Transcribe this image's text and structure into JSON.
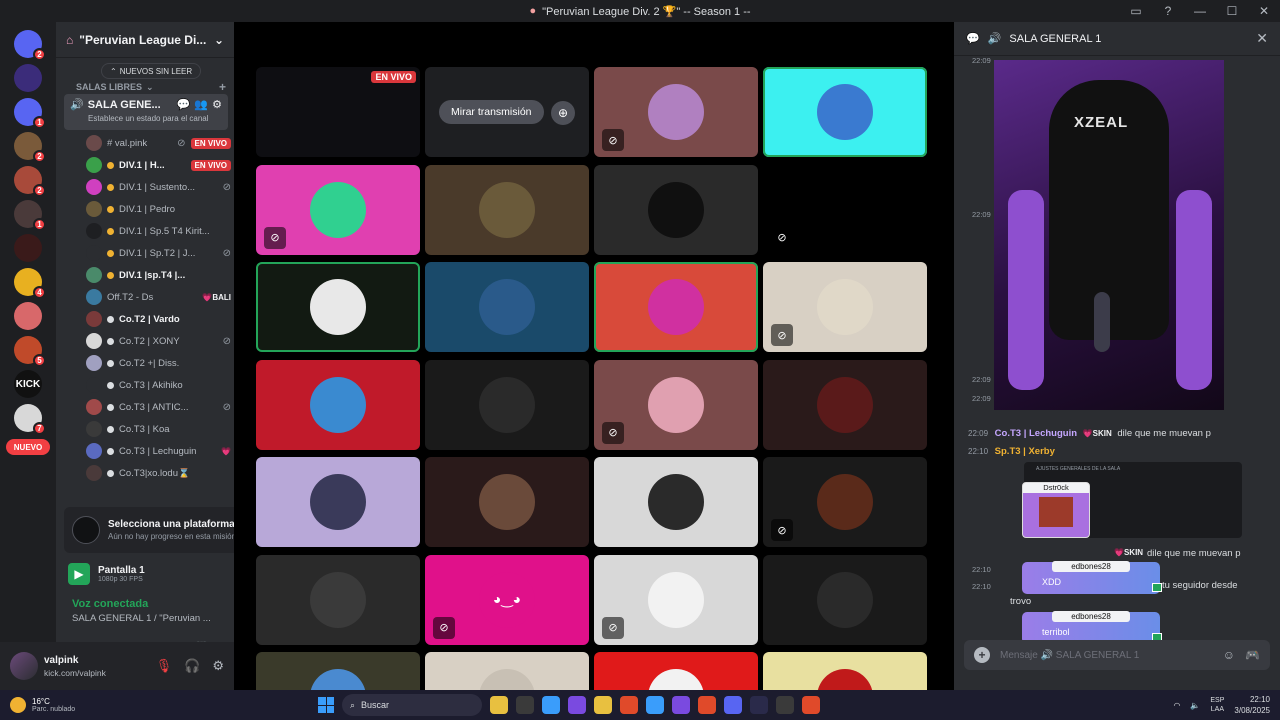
{
  "window": {
    "title": "\"Peruvian League Div. 2 🏆\" -- Season 1 --",
    "controls": [
      "▭",
      "?",
      "—",
      "☐",
      "✕"
    ]
  },
  "servers": [
    {
      "label": "",
      "color": "#5865f2",
      "badge": "2"
    },
    {
      "label": "",
      "color": "#3b2c7a",
      "badge": ""
    },
    {
      "label": "",
      "color": "#5865f2",
      "badge": "1"
    },
    {
      "label": "",
      "color": "#7a5a3a",
      "badge": "2"
    },
    {
      "label": "",
      "color": "#a84a3a",
      "badge": "2"
    },
    {
      "label": "",
      "color": "#4a3a3a",
      "badge": "1"
    },
    {
      "label": "",
      "color": "#3a1a1a",
      "badge": ""
    },
    {
      "label": "",
      "color": "#e8b020",
      "badge": "4"
    },
    {
      "label": "",
      "color": "#d8686a",
      "badge": ""
    },
    {
      "label": "",
      "color": "#c04a2a",
      "badge": "5"
    },
    {
      "label": "KICK",
      "color": "#111",
      "badge": ""
    },
    {
      "label": "",
      "color": "#d8d8d8",
      "badge": "7"
    }
  ],
  "nuevo_label": "NUEVO",
  "guild": {
    "name": "\"Peruvian League Di...",
    "unread_label": "NUEVOS SIN LEER",
    "category": "SALAS LIBRES",
    "channel_name": "SALA GENE...",
    "channel_status": "Establece un estado para el canal"
  },
  "members": [
    {
      "name": "# val.pink",
      "bold": false,
      "dot": "none",
      "avatar": "#6a4a4a",
      "live": "EN VIVO",
      "muted": true
    },
    {
      "name": "DIV.1 | H...",
      "bold": true,
      "dot": "yellow",
      "avatar": "#3aa04a",
      "live": "EN VIVO",
      "muted": false
    },
    {
      "name": "DIV.1 | Sustento...",
      "bold": false,
      "dot": "yellow",
      "avatar": "#d040c0",
      "live": "",
      "muted": true
    },
    {
      "name": "DIV.1 | Pedro",
      "bold": false,
      "dot": "yellow",
      "avatar": "#6a5a3a",
      "live": "",
      "muted": false
    },
    {
      "name": "DIV.1 | Sp.5 T4 Kirit...",
      "bold": false,
      "dot": "yellow",
      "avatar": "#1e1f22",
      "live": "",
      "muted": false
    },
    {
      "name": "DIV.1 | Sp.T2 | J...",
      "bold": false,
      "dot": "yellow",
      "avatar": "#2b2d31",
      "live": "",
      "muted": true
    },
    {
      "name": "DIV.1 |sp.T4 |...",
      "bold": true,
      "dot": "yellow",
      "avatar": "#4a8a6a",
      "live": "",
      "muted": false
    },
    {
      "name": "Off.T2 - Ds",
      "bold": false,
      "dot": "none",
      "avatar": "#3a7aa0",
      "live": "",
      "muted": false,
      "tag": "💗BALI"
    },
    {
      "name": "Co.T2 | Vardo",
      "bold": true,
      "dot": "white",
      "avatar": "#7a3a3a",
      "live": "",
      "muted": false
    },
    {
      "name": "Co.T2 | XONY",
      "bold": false,
      "dot": "white",
      "avatar": "#d8d8d8",
      "live": "",
      "muted": true
    },
    {
      "name": "Co.T2 +| Diss.",
      "bold": false,
      "dot": "white",
      "avatar": "#a0a0c0",
      "live": "",
      "muted": false
    },
    {
      "name": "Co.T3 | Akihiko",
      "bold": false,
      "dot": "white",
      "avatar": "#2b2d31",
      "live": "",
      "muted": false
    },
    {
      "name": "Co.T3 | ANTIC...",
      "bold": false,
      "dot": "white",
      "avatar": "#a04a4a",
      "live": "",
      "muted": true
    },
    {
      "name": "Co.T3 | Koa",
      "bold": false,
      "dot": "white",
      "avatar": "#3a3a3a",
      "live": "",
      "muted": false
    },
    {
      "name": "Co.T3 | Lechuguin",
      "bold": false,
      "dot": "white",
      "avatar": "#5a6ac0",
      "live": "",
      "muted": false,
      "tag": "💗"
    },
    {
      "name": "Co.T3|xo.lodu⌛",
      "bold": false,
      "dot": "white",
      "avatar": "#4a3a3a",
      "live": "",
      "muted": false
    }
  ],
  "quest": {
    "title": "Selecciona una plataforma",
    "subtitle": "Aún no hay progreso en esta misión"
  },
  "screenshare": {
    "title": "Pantalla 1",
    "subtitle": "1080p 30 FPS"
  },
  "voice": {
    "status": "Voz conectada",
    "channel": "SALA GENERAL 1 / \"Peruvian ..."
  },
  "user": {
    "name": "valpink",
    "status": "kick.com/valpink"
  },
  "stage": {
    "watch_label": "Mirar transmisión",
    "live_label": "EN VIVO",
    "tiles": [
      {
        "bg": "#0e0e12",
        "avatar": "",
        "live": true,
        "muted": false,
        "speaking": false
      },
      {
        "bg": "#1e1f22",
        "avatar": "",
        "live": false,
        "muted": false,
        "speaking": false,
        "watch": true
      },
      {
        "bg": "#7a4a4a",
        "avatar": "#b080c0",
        "live": false,
        "muted": true,
        "speaking": false
      },
      {
        "bg": "#3cf0f0",
        "avatar": "#3a7ad0",
        "live": false,
        "muted": false,
        "speaking": true
      },
      {
        "bg": "#e040b0",
        "avatar": "#30d090",
        "live": false,
        "muted": true,
        "speaking": false
      },
      {
        "bg": "#4a3a2a",
        "avatar": "#6a5a3a",
        "live": false,
        "muted": false,
        "speaking": false
      },
      {
        "bg": "#2a2a2a",
        "avatar": "#101010",
        "live": false,
        "muted": false,
        "speaking": false
      },
      {
        "bg": "#000000",
        "avatar": "",
        "live": false,
        "muted": true,
        "speaking": false
      },
      {
        "bg": "#121a12",
        "avatar": "#e8e8e8",
        "live": false,
        "muted": false,
        "speaking": true
      },
      {
        "bg": "#1a4a6a",
        "avatar": "#2a5a8a",
        "live": false,
        "muted": false,
        "speaking": false
      },
      {
        "bg": "#d84a3a",
        "avatar": "#d030a0",
        "live": false,
        "muted": false,
        "speaking": true
      },
      {
        "bg": "#d8d0c4",
        "avatar": "#e0d8c8",
        "live": false,
        "muted": true,
        "speaking": false
      },
      {
        "bg": "#c01a2a",
        "avatar": "#3a8ad0",
        "live": false,
        "muted": false,
        "speaking": false
      },
      {
        "bg": "#1a1a1a",
        "avatar": "#2a2a2a",
        "live": false,
        "muted": false,
        "speaking": false
      },
      {
        "bg": "#7a4a4a",
        "avatar": "#e0a0b0",
        "live": false,
        "muted": true,
        "speaking": false
      },
      {
        "bg": "#2a1a1a",
        "avatar": "#5a1a1a",
        "live": false,
        "muted": false,
        "speaking": false
      },
      {
        "bg": "#b8a8d8",
        "avatar": "#3a3a5a",
        "live": false,
        "muted": false,
        "speaking": false
      },
      {
        "bg": "#2a1a1a",
        "avatar": "#6a4a3a",
        "live": false,
        "muted": false,
        "speaking": false
      },
      {
        "bg": "#d8d8d8",
        "avatar": "#2a2a2a",
        "live": false,
        "muted": false,
        "speaking": false
      },
      {
        "bg": "#1a1a1a",
        "avatar": "#5a2a1a",
        "live": false,
        "muted": true,
        "speaking": false
      },
      {
        "bg": "#2a2a2a",
        "avatar": "#3a3a3a",
        "live": false,
        "muted": false,
        "speaking": false
      },
      {
        "bg": "#e0118a",
        "avatar": "#e0118a",
        "live": false,
        "muted": true,
        "speaking": false,
        "discord": true
      },
      {
        "bg": "#d8d8d8",
        "avatar": "#f2f2f2",
        "live": false,
        "muted": true,
        "speaking": false
      },
      {
        "bg": "#1a1a1a",
        "avatar": "#2a2a2a",
        "live": false,
        "muted": false,
        "speaking": false
      },
      {
        "bg": "#3a3a2a",
        "avatar": "#4a8ad0",
        "live": false,
        "muted": false,
        "speaking": false
      },
      {
        "bg": "#d8d0c4",
        "avatar": "#c8c0b4",
        "live": false,
        "muted": false,
        "speaking": false
      },
      {
        "bg": "#e01a1a",
        "avatar": "#f2f2f2",
        "live": false,
        "muted": false,
        "speaking": false
      },
      {
        "bg": "#e8e0a0",
        "avatar": "#c01a1a",
        "live": false,
        "muted": false,
        "speaking": false
      }
    ]
  },
  "chat": {
    "header": "SALA GENERAL 1",
    "brand": "XZEAL",
    "side_times": [
      "22:09",
      "22:09",
      "22:09",
      "22:09"
    ],
    "messages": [
      {
        "time": "22:09",
        "user": "Co.T3 | Lechuguin",
        "skin": "💗SKIN",
        "text": "dile que me muevan p"
      },
      {
        "time": "22:10",
        "user": "Sp.T3 | Xerby",
        "skin": "",
        "text": ""
      }
    ],
    "overlay_title": "AJUSTES GENERALES DE LA SALA",
    "card_name": "Dstr0ck",
    "reply_skin": "💗SKIN",
    "reply_text": "dile que me muevan p",
    "follow_time_1": "22:10",
    "follow_time_2": "22:10",
    "follow_text": "tu seguidor desde",
    "follow_text2": "trovo",
    "pills": [
      {
        "name": "edbones28",
        "value": "XDD"
      },
      {
        "name": "edbones28",
        "value": "terribol"
      }
    ],
    "input_placeholder": "Mensaje 🔊 SALA GENERAL 1"
  },
  "taskbar": {
    "temp": "16°C",
    "weather": "Parc. nublado",
    "search": "Buscar",
    "lang1": "ESP",
    "lang2": "LAA",
    "time": "22:10",
    "date": "3/08/2025",
    "apps": [
      "#e8c040",
      "#3a3a3a",
      "#3a9dfb",
      "#7a4ae0",
      "#e8c040",
      "#e04a2a",
      "#3a9dfb",
      "#7a4ae0",
      "#e04a2a",
      "#5865f2",
      "#2a2a4a",
      "#3a3a3a",
      "#e04a2a"
    ]
  }
}
